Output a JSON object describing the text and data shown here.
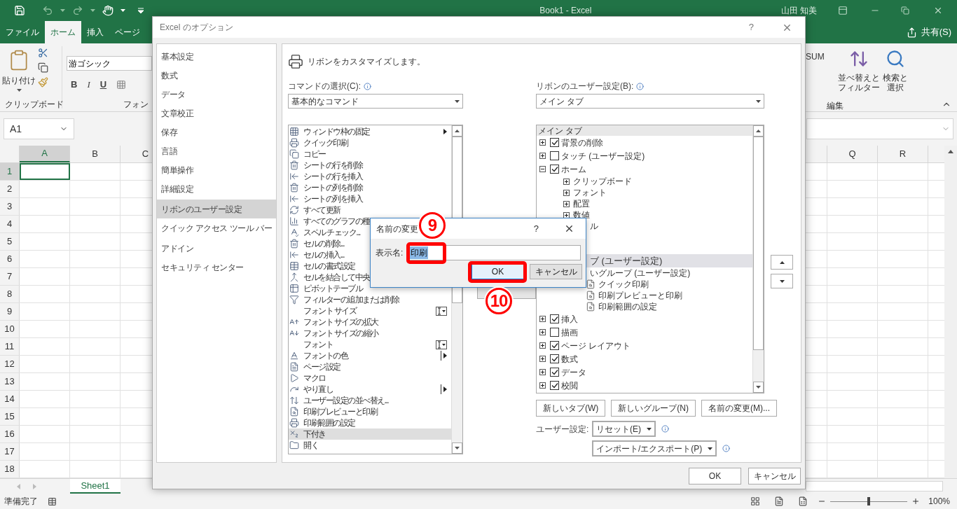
{
  "excel": {
    "title": "Book1 - Excel",
    "user": "山田 知美",
    "tabs": [
      {
        "label": "ファイル",
        "selected": false
      },
      {
        "label": "ホーム",
        "selected": true
      },
      {
        "label": "挿入",
        "selected": false
      },
      {
        "label": "ページ",
        "selected": false
      }
    ],
    "share": "共有(S)",
    "ribbon": {
      "paste": "貼り付け",
      "clipboard_group": "クリップボード",
      "font_name": "游ゴシック",
      "font_group": "フォン",
      "bold": "B",
      "italic": "I",
      "underline": "U",
      "autosum": "SUM",
      "sort_filter": [
        "並べ替えと",
        "フィルター"
      ],
      "find_select": [
        "検索と",
        "選択"
      ],
      "editing_group": "編集"
    },
    "name_box": "A1",
    "columns_left": [
      {
        "label": "A",
        "selected": true
      },
      {
        "label": "B",
        "selected": false
      },
      {
        "label": "C",
        "selected": false
      }
    ],
    "columns_right": [
      {
        "label": "Q",
        "selected": false
      },
      {
        "label": "R",
        "selected": false
      }
    ],
    "rows": [
      {
        "label": "1",
        "selected": true
      },
      {
        "label": "2",
        "selected": false
      },
      {
        "label": "3",
        "selected": false
      },
      {
        "label": "4",
        "selected": false
      },
      {
        "label": "5",
        "selected": false
      },
      {
        "label": "6",
        "selected": false
      },
      {
        "label": "7",
        "selected": false
      },
      {
        "label": "8",
        "selected": false
      },
      {
        "label": "9",
        "selected": false
      },
      {
        "label": "10",
        "selected": false
      },
      {
        "label": "11",
        "selected": false
      },
      {
        "label": "12",
        "selected": false
      },
      {
        "label": "13",
        "selected": false
      },
      {
        "label": "14",
        "selected": false
      },
      {
        "label": "15",
        "selected": false
      },
      {
        "label": "16",
        "selected": false
      },
      {
        "label": "17",
        "selected": false
      },
      {
        "label": "18",
        "selected": false
      }
    ],
    "sheet_tabs": [
      {
        "label": "Sheet1",
        "selected": true
      }
    ],
    "status": "準備完了",
    "zoom": "100%",
    "zoom_slider": {
      "level": 0.5
    }
  },
  "options_dialog": {
    "title": "Excel のオプション",
    "help": "?",
    "nav": [
      {
        "label": "基本設定",
        "selected": false
      },
      {
        "label": "数式",
        "selected": false
      },
      {
        "label": "データ",
        "selected": false
      },
      {
        "label": "文章校正",
        "selected": false
      },
      {
        "label": "保存",
        "selected": false
      },
      {
        "label": "言語",
        "selected": false
      },
      {
        "label": "簡単操作",
        "selected": false
      },
      {
        "label": "詳細設定",
        "selected": false
      },
      {
        "label": "リボンのユーザー設定",
        "selected": true
      },
      {
        "label": "クイック アクセス ツール バー",
        "selected": false
      },
      {
        "label": "アドイン",
        "selected": false
      },
      {
        "label": "セキュリティ センター",
        "selected": false
      }
    ],
    "heading": "リボンをカスタマイズします。",
    "commands_label": "コマンドの選択(C):",
    "commands_value": "基本的なコマンド",
    "commands": [
      {
        "label": "ウィンドウ枠の固定",
        "selected": false,
        "kind": "submenu"
      },
      {
        "label": "クイック印刷",
        "selected": false,
        "kind": "plain"
      },
      {
        "label": "コピー",
        "selected": false,
        "kind": "plain"
      },
      {
        "label": "シートの行を削除",
        "selected": false,
        "kind": "plain"
      },
      {
        "label": "シートの行を挿入",
        "selected": false,
        "kind": "plain"
      },
      {
        "label": "シートの列を削除",
        "selected": false,
        "kind": "plain"
      },
      {
        "label": "シートの列を挿入",
        "selected": false,
        "kind": "plain"
      },
      {
        "label": "すべて更新",
        "selected": false,
        "kind": "plain"
      },
      {
        "label": "すべてのグラフの種",
        "selected": false,
        "kind": "plain"
      },
      {
        "label": "スペル チェック...",
        "selected": false,
        "kind": "plain"
      },
      {
        "label": "セルの削除...",
        "selected": false,
        "kind": "plain"
      },
      {
        "label": "セルの挿入...",
        "selected": false,
        "kind": "plain"
      },
      {
        "label": "セルの書式設定",
        "selected": false,
        "kind": "plain"
      },
      {
        "label": "セルを結合して中央",
        "selected": false,
        "kind": "plain"
      },
      {
        "label": "ピボットテーブル",
        "selected": false,
        "kind": "plain"
      },
      {
        "label": "フィルターの追加または削除",
        "selected": false,
        "kind": "plain"
      },
      {
        "label": "フォント サイズ",
        "selected": false,
        "kind": "field"
      },
      {
        "label": "フォント サイズの拡大",
        "selected": false,
        "kind": "plain"
      },
      {
        "label": "フォント サイズの縮小",
        "selected": false,
        "kind": "plain"
      },
      {
        "label": "フォント",
        "selected": false,
        "kind": "field"
      },
      {
        "label": "フォントの色",
        "selected": false,
        "kind": "split"
      },
      {
        "label": "ページ設定",
        "selected": false,
        "kind": "plain"
      },
      {
        "label": "マクロ",
        "selected": false,
        "kind": "plain"
      },
      {
        "label": "やり直し",
        "selected": false,
        "kind": "split"
      },
      {
        "label": "ユーザー設定の並べ替え...",
        "selected": false,
        "kind": "plain"
      },
      {
        "label": "印刷プレビューと印刷",
        "selected": false,
        "kind": "plain"
      },
      {
        "label": "印刷範囲の設定",
        "selected": false,
        "kind": "plain"
      },
      {
        "label": "下付き",
        "selected": true,
        "kind": "plain"
      },
      {
        "label": "開く",
        "selected": false,
        "kind": "plain"
      }
    ],
    "ribbon_label": "リボンのユーザー設定(B):",
    "ribbon_value": "メイン タブ",
    "tree": {
      "header": "メイン タブ",
      "items": [
        {
          "label": "背景の削除",
          "checked": true,
          "expanded": false,
          "selected": false
        },
        {
          "label": "タッチ (ユーザー設定)",
          "checked": false,
          "expanded": false,
          "selected": false
        },
        {
          "label": "ホーム",
          "checked": true,
          "expanded": true,
          "selected": false,
          "children": [
            {
              "label": "クリップボード",
              "expanded": false,
              "selected": false
            },
            {
              "label": "フォント",
              "expanded": false,
              "selected": false
            },
            {
              "label": "配置",
              "expanded": false,
              "selected": false
            },
            {
              "label": "数値",
              "expanded": false,
              "selected": false
            },
            {
              "label": "ル",
              "kind": "covered",
              "selected": false
            }
          ]
        },
        {
          "label": "ブ (ユーザー設定)",
          "kind": "covered",
          "selected": true,
          "children": [
            {
              "label": "いグループ (ユーザー設定)",
              "kind": "covered",
              "selected": false,
              "children": [
                {
                  "label": "クイック印刷",
                  "selected": false
                },
                {
                  "label": "印刷プレビューと印刷",
                  "selected": false
                },
                {
                  "label": "印刷範囲の設定",
                  "selected": false
                }
              ]
            }
          ]
        },
        {
          "label": "挿入",
          "checked": true,
          "expanded": false,
          "selected": false
        },
        {
          "label": "描画",
          "checked": false,
          "expanded": false,
          "selected": false
        },
        {
          "label": "ページ レイアウト",
          "checked": true,
          "expanded": false,
          "selected": false
        },
        {
          "label": "数式",
          "checked": true,
          "expanded": false,
          "selected": false
        },
        {
          "label": "データ",
          "checked": true,
          "expanded": false,
          "selected": false
        },
        {
          "label": "校閲",
          "checked": true,
          "expanded": false,
          "selected": false
        }
      ]
    },
    "tree_buttons": [
      "新しいタブ(W)",
      "新しいグループ(N)",
      "名前の変更(M)..."
    ],
    "customize_label": "ユーザー設定:",
    "reset": "リセット(E)",
    "import_export": "インポート/エクスポート(P)",
    "buttons": [
      "OK",
      "キャンセル"
    ]
  },
  "rename_dialog": {
    "title": "名前の変更",
    "help": "?",
    "field_label": "表示名:",
    "value": "印刷",
    "buttons": [
      {
        "label": "OK",
        "focused": true
      },
      {
        "label": "キャンセル",
        "focused": false
      }
    ]
  },
  "annotations": [
    {
      "label": "9"
    },
    {
      "label": "10"
    }
  ]
}
